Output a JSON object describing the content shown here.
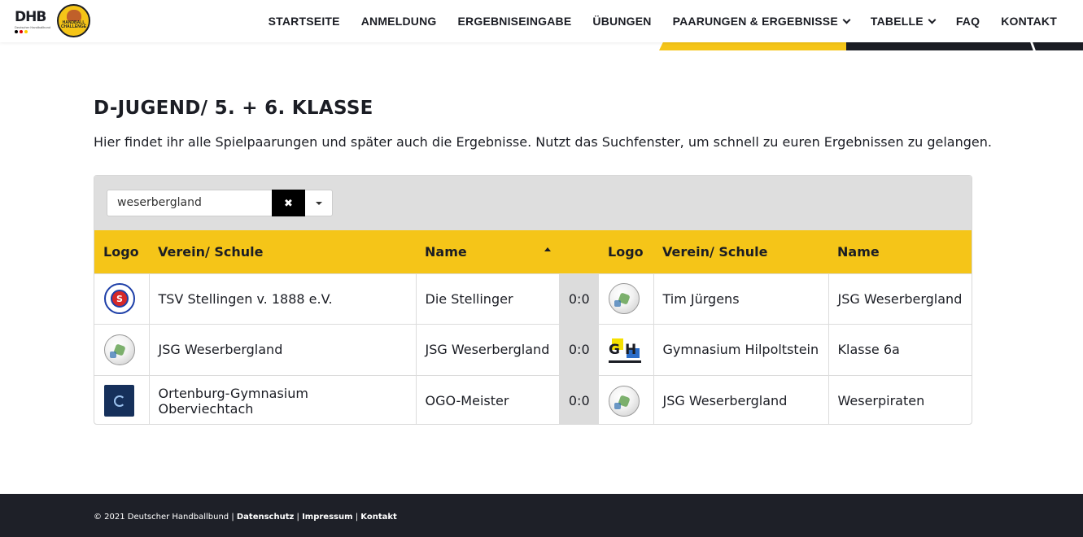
{
  "header": {
    "dhb_logo_text": "DHB",
    "dhb_logo_sub": "Deutscher Handballbund",
    "challenge_logo_text": "HANDBALL CHALLENGE",
    "nav": [
      {
        "label": "STARTSEITE",
        "dropdown": false
      },
      {
        "label": "ANMELDUNG",
        "dropdown": false
      },
      {
        "label": "ERGEBNISEINGABE",
        "dropdown": false
      },
      {
        "label": "ÜBUNGEN",
        "dropdown": false
      },
      {
        "label": "PAARUNGEN & ERGEBNISSE",
        "dropdown": true
      },
      {
        "label": "TABELLE",
        "dropdown": true
      },
      {
        "label": "FAQ",
        "dropdown": false
      },
      {
        "label": "KONTAKT",
        "dropdown": false
      }
    ]
  },
  "main": {
    "title": "D-JUGEND/ 5. + 6. KLASSE",
    "intro": "Hier findet ihr alle Spielpaarungen und später auch die Ergebnisse. Nutzt das Suchfenster, um schnell zu euren Ergebnissen zu gelangen."
  },
  "search": {
    "value": "weserbergland",
    "clear_label": "✖"
  },
  "table": {
    "headers": [
      "Logo",
      "Verein/ Schule",
      "Name",
      "",
      "Logo",
      "Verein/ Schule",
      "Name"
    ],
    "sorted_column": "Name",
    "rows": [
      {
        "home_logo": "tsv-stellingen-logo",
        "home_club": "TSV Stellingen v. 1888 e.V.",
        "home_name": "Die Stellinger",
        "score": "0:0",
        "away_logo": "jsg-weserbergland-logo",
        "away_club": "Tim Jürgens",
        "away_name": "JSG Weserbergland"
      },
      {
        "home_logo": "jsg-weserbergland-logo",
        "home_club": "JSG Weserbergland",
        "home_name": "JSG Weserbergland",
        "score": "0:0",
        "away_logo": "gymnasium-hilpoltstein-logo",
        "away_club": "Gymnasium Hilpoltstein",
        "away_name": "Klasse 6a"
      },
      {
        "home_logo": "ortenburg-gymnasium-logo",
        "home_club": "Ortenburg-Gymnasium Oberviechtach",
        "home_name": "OGO-Meister",
        "score": "0:0",
        "away_logo": "jsg-weserbergland-logo",
        "away_club": "JSG Weserbergland",
        "away_name": "Weserpiraten"
      }
    ]
  },
  "footer": {
    "copyright": "© 2021 Deutscher Handballbund | ",
    "link_privacy": "Datenschutz",
    "sep1": " | ",
    "link_imprint": "Impressum",
    "sep2": " | ",
    "link_contact": "Kontakt"
  },
  "colors": {
    "accent_yellow": "#f5c518",
    "dark": "#1e2028",
    "toolbar_gray": "#dedede"
  }
}
